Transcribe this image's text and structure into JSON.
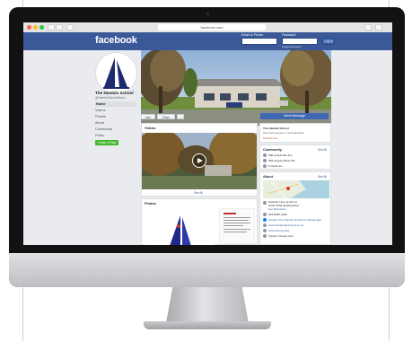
{
  "browser": {
    "url": "facebook.com"
  },
  "facebook": {
    "logo": "facebook",
    "login": {
      "email_label": "Email or Phone",
      "password_label": "Password",
      "button": "Log In",
      "forgot": "Forgot account?"
    }
  },
  "page": {
    "name": "The Hamble School",
    "handle": "@HambleSchoolSoton",
    "nav": [
      "Home",
      "Videos",
      "Photos",
      "About",
      "Community",
      "Posts"
    ],
    "create_page": "Create a Page",
    "action_like": "Like",
    "action_share": "Share",
    "action_more": "...",
    "send_message": "Send Message"
  },
  "intro": {
    "title": "The Hamble School",
    "subtitle": "School/university in Southampton",
    "link": "Closed now"
  },
  "videos": {
    "title": "Videos",
    "see_all": "See All"
  },
  "photos": {
    "title": "Photos"
  },
  "community": {
    "title": "Community",
    "see_all": "See All",
    "items": [
      "598 people like this",
      "583 people follow this",
      "8 check-ins"
    ]
  },
  "about": {
    "title": "About",
    "see_all": "See All",
    "address_line1": "Satchell Lane (2.09 mi)",
    "address_line2": "SO31 4NQ Southampton",
    "directions": "Get Directions",
    "phone": "023 8045 2105",
    "message": "Contact The Hamble School on Messenger",
    "website": "www.thehambleschool.co.uk",
    "category": "School/university",
    "hours": "Typical: Closed now"
  },
  "colors": {
    "facebook_blue": "#3b5998",
    "button_blue": "#4267b2",
    "green": "#42b72a"
  }
}
